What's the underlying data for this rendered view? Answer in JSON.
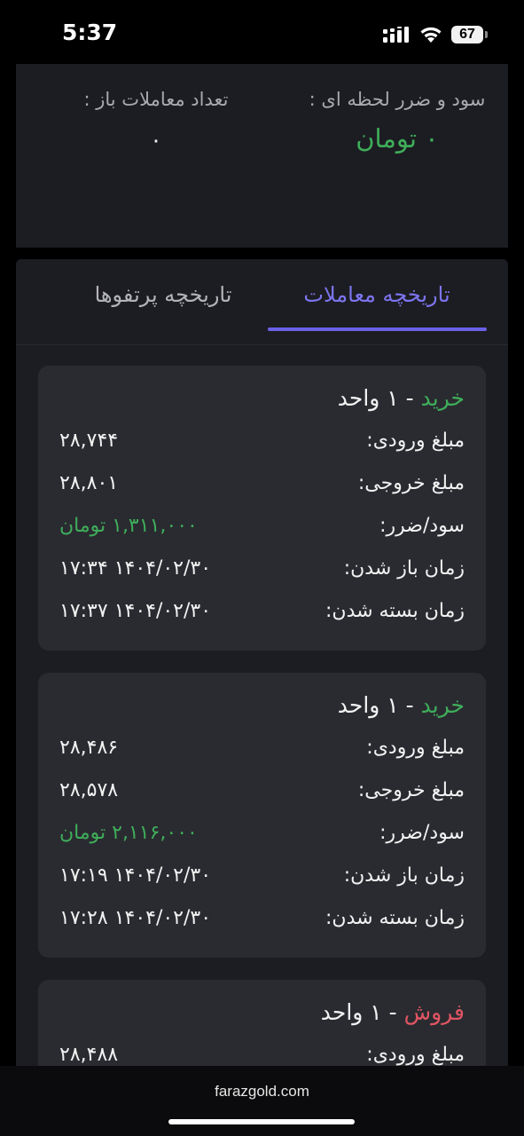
{
  "status_bar": {
    "time": "5:37",
    "battery": "67"
  },
  "summary": {
    "pnl_label": "سود و ضرر لحظه ای :",
    "pnl_value": "۰ تومان",
    "open_trades_label": "تعداد معاملات باز :",
    "open_trades_value": "۰"
  },
  "tabs": [
    {
      "label": "تاریخچه معاملات",
      "active": true
    },
    {
      "label": "تاریخچه پرتفوها",
      "active": false
    }
  ],
  "trades": [
    {
      "side": "خرید",
      "qty": " - ۱ واحد",
      "rows": [
        {
          "label": "مبلغ ورودی:",
          "value": "۲۸,۷۴۴"
        },
        {
          "label": "مبلغ خروجی:",
          "value": "۲۸,۸۰۱"
        },
        {
          "label": "سود/ضرر:",
          "value": "۱,۳۱۱,۰۰۰ تومان"
        },
        {
          "label": "زمان باز شدن:",
          "value": "۱۴۰۴/۰۲/۳۰ ۱۷:۳۴"
        },
        {
          "label": "زمان بسته شدن:",
          "value": "۱۴۰۴/۰۲/۳۰ ۱۷:۳۷"
        }
      ]
    },
    {
      "side": "خرید",
      "qty": " - ۱ واحد",
      "rows": [
        {
          "label": "مبلغ ورودی:",
          "value": "۲۸,۴۸۶"
        },
        {
          "label": "مبلغ خروجی:",
          "value": "۲۸,۵۷۸"
        },
        {
          "label": "سود/ضرر:",
          "value": "۲,۱۱۶,۰۰۰ تومان"
        },
        {
          "label": "زمان باز شدن:",
          "value": "۱۴۰۴/۰۲/۳۰ ۱۷:۱۹"
        },
        {
          "label": "زمان بسته شدن:",
          "value": "۱۴۰۴/۰۲/۳۰ ۱۷:۲۸"
        }
      ]
    },
    {
      "side": "فروش",
      "qty": " - ۱ واحد",
      "rows": [
        {
          "label": "مبلغ ورودی:",
          "value": "۲۸,۴۸۸"
        }
      ]
    }
  ],
  "url_bar": {
    "url": "farazgold.com"
  },
  "colors": {
    "accent": "#6a61e8",
    "profit": "#3fae5a",
    "sell": "#e05562",
    "card": "#2a2b31",
    "panel": "#1c1d22"
  }
}
